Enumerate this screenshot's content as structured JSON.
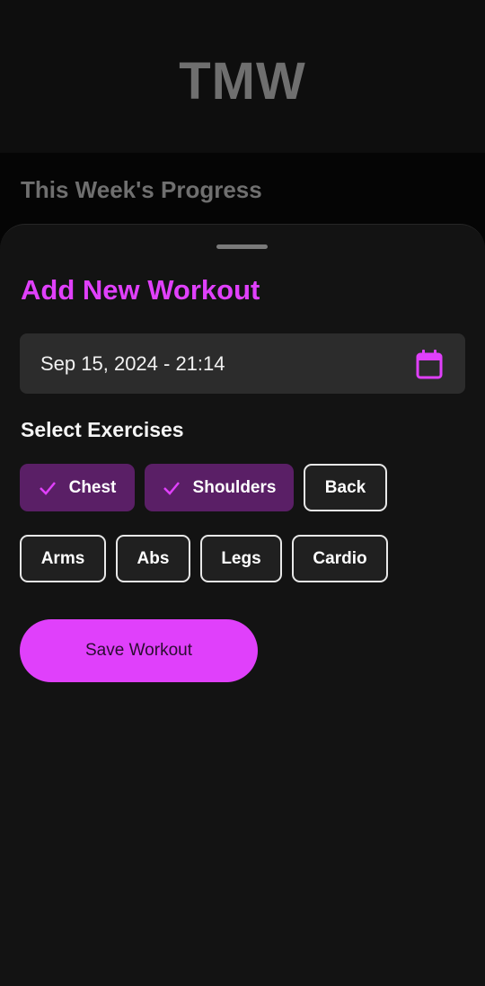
{
  "app": {
    "title": "TMW"
  },
  "background_section": {
    "title": "This Week's Progress"
  },
  "sheet": {
    "title": "Add New Workout",
    "date_field": {
      "value": "Sep 15, 2024 - 21:14",
      "icon": "calendar-icon"
    },
    "exercises_label": "Select Exercises",
    "chips": [
      {
        "label": "Chest",
        "selected": true
      },
      {
        "label": "Shoulders",
        "selected": true
      },
      {
        "label": "Back",
        "selected": false
      },
      {
        "label": "Arms",
        "selected": false
      },
      {
        "label": "Abs",
        "selected": false
      },
      {
        "label": "Legs",
        "selected": false
      },
      {
        "label": "Cardio",
        "selected": false
      }
    ],
    "save_label": "Save Workout"
  },
  "colors": {
    "accent": "#e040fb",
    "selected_chip": "#5a1f66",
    "sheet_background": "#131313",
    "field_background": "#2c2c2c"
  }
}
